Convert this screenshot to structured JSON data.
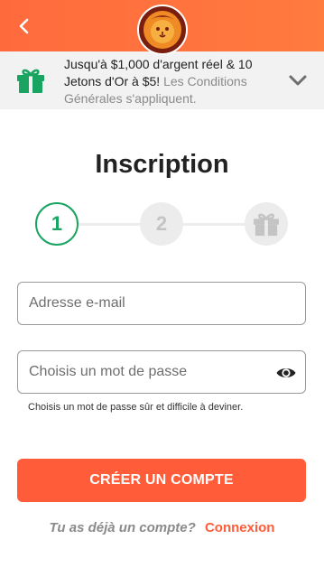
{
  "header": {
    "back_icon": "chevron-left-icon",
    "logo_icon": "lion-logo-icon",
    "brand_color": "#ff6a3d"
  },
  "promo": {
    "gift_icon": "gift-icon",
    "text_main": "Jusqu'à $1,000 d'argent réel & 10 Jetons d'Or à $5!",
    "text_terms": "Les Conditions Générales s'appliquent.",
    "chevron_icon": "chevron-down-icon",
    "gift_color": "#1aa461"
  },
  "page": {
    "title": "Inscription"
  },
  "stepper": {
    "steps": [
      {
        "label": "1",
        "state": "active"
      },
      {
        "label": "2",
        "state": "inactive"
      },
      {
        "label": "",
        "icon": "gift-icon",
        "state": "inactive"
      }
    ],
    "active_color": "#1aa461"
  },
  "form": {
    "email_placeholder": "Adresse e-mail",
    "email_value": "",
    "password_placeholder": "Choisis un mot de passe",
    "password_value": "",
    "eye_icon": "eye-icon",
    "password_hint": "Choisis un mot de passe sûr et difficile à deviner.",
    "submit_label": "CRÉER UN COMPTE",
    "cta_color": "#ff5c39"
  },
  "login": {
    "question": "Tu as déjà un compte?",
    "link_label": "Connexion"
  }
}
